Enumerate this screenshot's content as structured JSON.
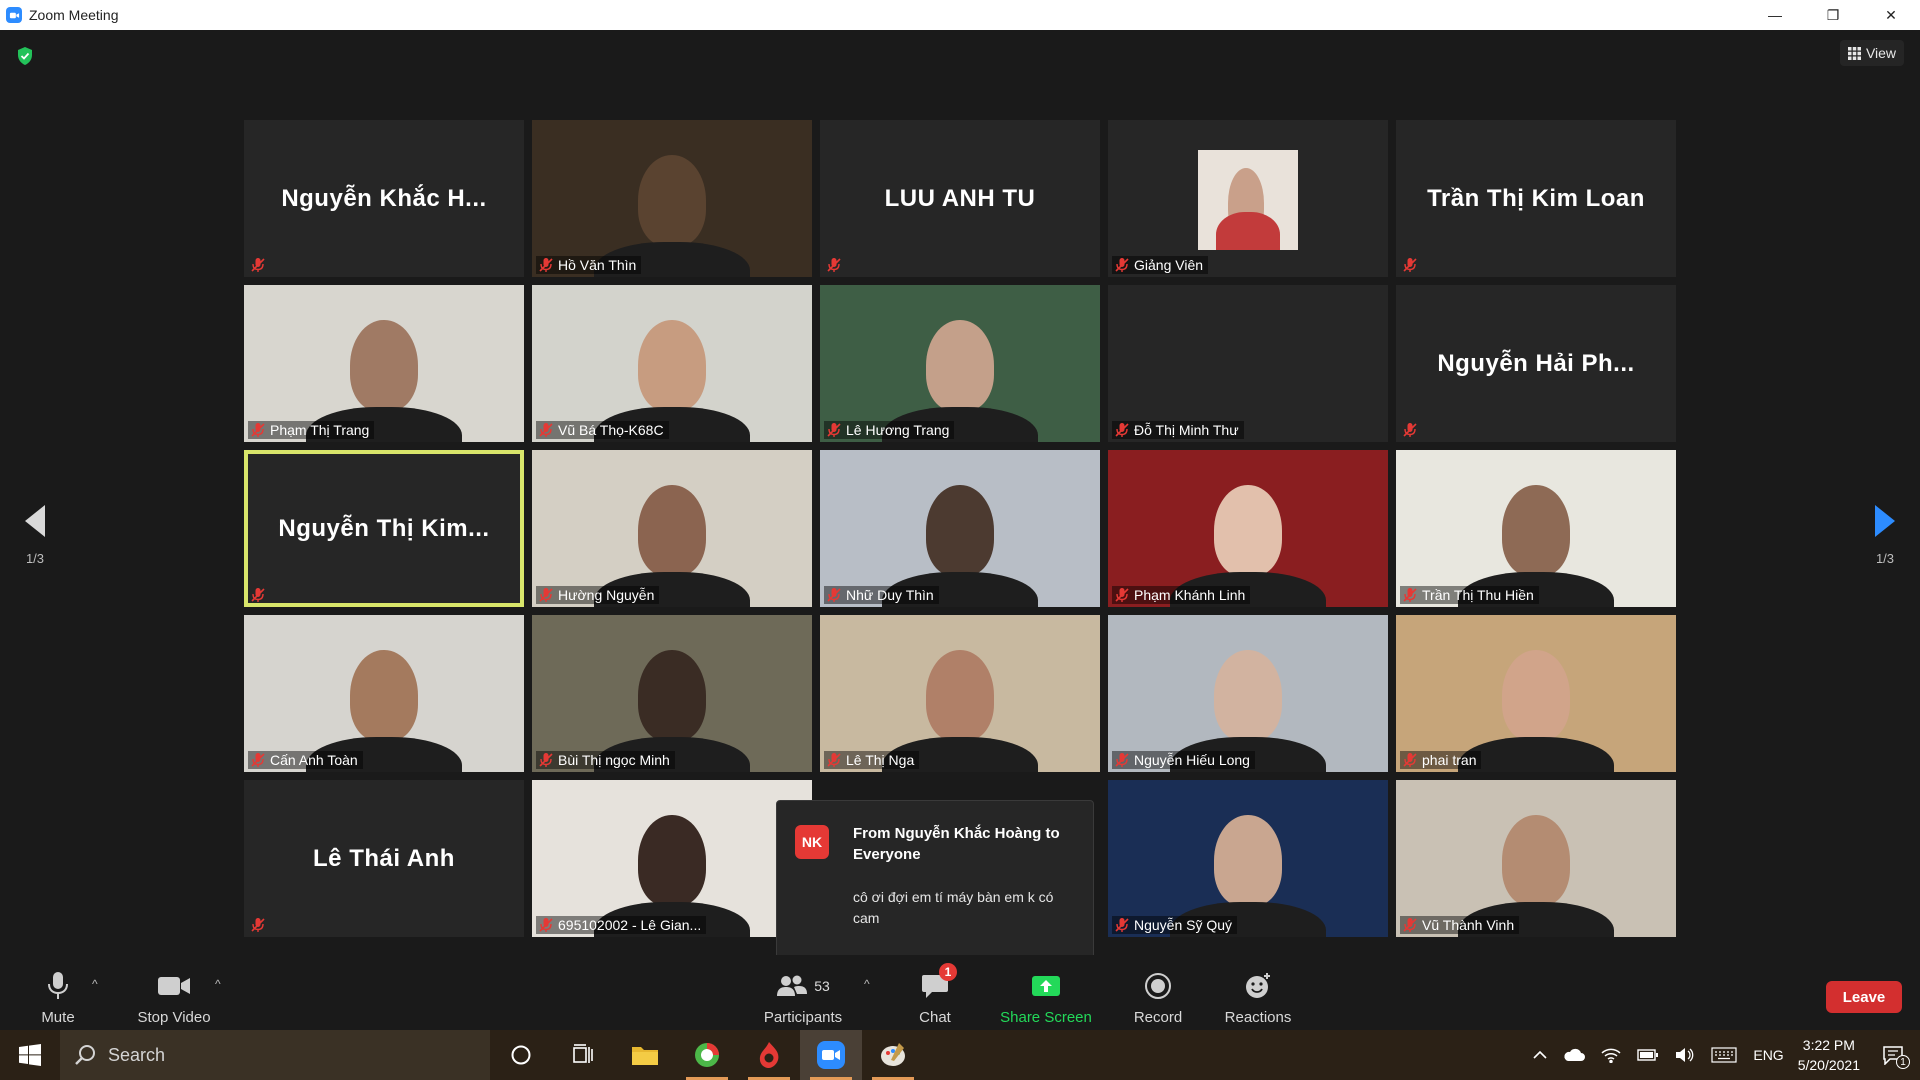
{
  "window": {
    "title": "Zoom Meeting",
    "minimize": "—",
    "restore": "❐",
    "close": "✕"
  },
  "top": {
    "view_label": "View"
  },
  "pager": {
    "left": "1/3",
    "right": "1/3"
  },
  "tiles": [
    {
      "type": "name",
      "name": "Nguyễn Khắc H..."
    },
    {
      "type": "video",
      "name": "Hồ Văn Thìn",
      "bg": "#3a2e22",
      "skin": "#5a4330"
    },
    {
      "type": "name",
      "name": "LUU ANH TU"
    },
    {
      "type": "photo",
      "name": "Giảng Viên",
      "bg": "#262626",
      "skin": "#c9a08a"
    },
    {
      "type": "name",
      "name": "Trần Thị Kim Loan"
    },
    {
      "type": "video",
      "name": "Phạm Thị Trang",
      "bg": "#d8d6cf",
      "skin": "#a07a64"
    },
    {
      "type": "video",
      "name": "Vũ Bá Thọ-K68C",
      "bg": "#d3d3cc",
      "skin": "#c79c80"
    },
    {
      "type": "video",
      "name": "Lê Hương Trang",
      "bg": "#3e5e45",
      "skin": "#c4a08a"
    },
    {
      "type": "empty",
      "name": "Đỗ Thị Minh Thư"
    },
    {
      "type": "name",
      "name": "Nguyễn Hải Ph..."
    },
    {
      "type": "name",
      "name": "Nguyễn Thị Kim...",
      "active": true
    },
    {
      "type": "video",
      "name": "Hường Nguyễn",
      "bg": "#d4cfc4",
      "skin": "#8b6450"
    },
    {
      "type": "video",
      "name": "Nhữ Duy Thìn",
      "bg": "#b8bec6",
      "skin": "#4c3a30"
    },
    {
      "type": "video",
      "name": "Phạm Khánh Linh",
      "bg": "#8a1e20",
      "skin": "#e2c0ac"
    },
    {
      "type": "video",
      "name": "Trần Thị Thu Hiền",
      "bg": "#e8e7df",
      "skin": "#8e6a55"
    },
    {
      "type": "video",
      "name": "Cấn Anh Toàn",
      "bg": "#d6d4cf",
      "skin": "#a47a5e"
    },
    {
      "type": "video",
      "name": "Bùi Thị ngọc Minh",
      "bg": "#6e6a58",
      "skin": "#3a2c24"
    },
    {
      "type": "video",
      "name": "Lê Thị Nga",
      "bg": "#c8b9a0",
      "skin": "#b08068"
    },
    {
      "type": "video",
      "name": "Nguyễn Hiếu Long",
      "bg": "#b2b8bf",
      "skin": "#d2b3a0"
    },
    {
      "type": "video",
      "name": "phai tran",
      "bg": "#c6a57a",
      "skin": "#d1a48a"
    },
    {
      "type": "name",
      "name": "Lê Thái Anh"
    },
    {
      "type": "video",
      "name": "695102002 - Lê Gian...",
      "bg": "#e6e2dc",
      "skin": "#3a2a24"
    },
    {
      "type": "hidden",
      "name": ""
    },
    {
      "type": "video",
      "name": "Nguyễn Sỹ Quý",
      "bg": "#1a2e55",
      "skin": "#c9a690"
    },
    {
      "type": "video",
      "name": "Vũ Thành Vinh",
      "bg": "#c9c1b4",
      "skin": "#b48c72"
    }
  ],
  "chat_toast": {
    "avatar": "NK",
    "from": "From Nguyễn Khắc Hoàng to Everyone",
    "message": "cô ơi đợi em tí máy bàn em k có cam"
  },
  "toolbar": {
    "mute": "Mute",
    "stop_video": "Stop Video",
    "participants": "Participants",
    "participants_count": "53",
    "chat": "Chat",
    "chat_badge": "1",
    "share_screen": "Share Screen",
    "record": "Record",
    "reactions": "Reactions",
    "leave": "Leave",
    "share_color": "#23d959"
  },
  "taskbar": {
    "search_placeholder": "Search",
    "lang": "ENG",
    "time": "3:22 PM",
    "date": "5/20/2021",
    "notification_count": "1"
  }
}
